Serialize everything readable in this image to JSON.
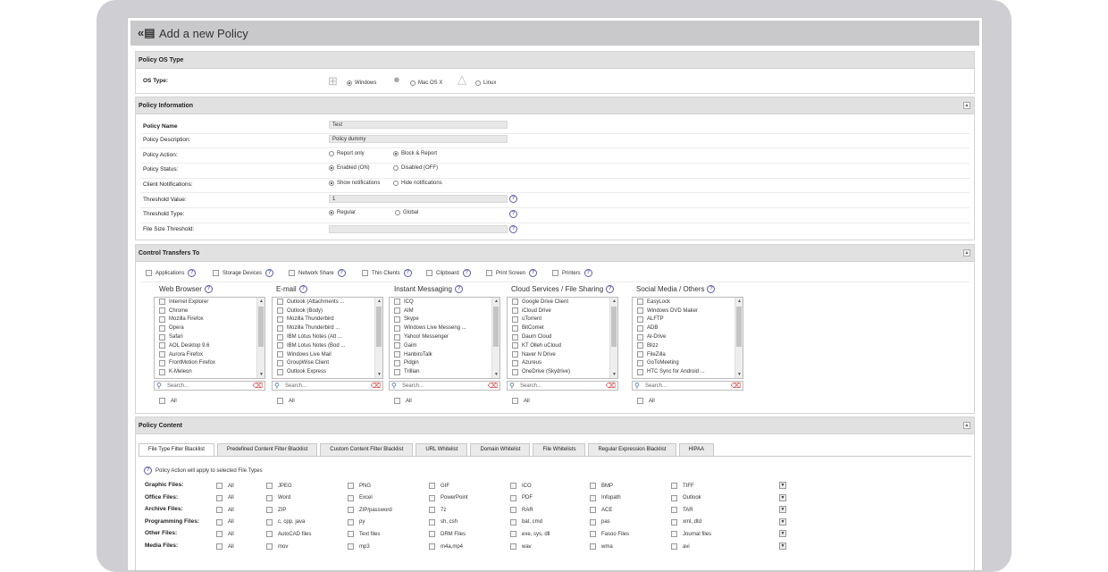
{
  "window": {
    "title": "Add a new Policy",
    "back_glyph": "«"
  },
  "os_type": {
    "header": "Policy OS Type",
    "label": "OS Type:",
    "options": [
      {
        "label": "Windows",
        "selected": true
      },
      {
        "label": "Mac OS X",
        "selected": false
      },
      {
        "label": "Linux",
        "selected": false
      }
    ]
  },
  "policy_info": {
    "header": "Policy Information",
    "name_label": "Policy Name",
    "name_value": "Test",
    "description_label": "Policy Description:",
    "description_value": "Policy dummy",
    "action_label": "Policy Action:",
    "action_options": [
      {
        "label": "Report only",
        "selected": false
      },
      {
        "label": "Block & Report",
        "selected": true
      }
    ],
    "status_label": "Policy Status:",
    "status_options": [
      {
        "label": "Enabled (ON)",
        "selected": true
      },
      {
        "label": "Disabled (OFF)",
        "selected": false
      }
    ],
    "notifications_label": "Client Notifications:",
    "notifications_options": [
      {
        "label": "Show notifications",
        "selected": true
      },
      {
        "label": "Hide notifications",
        "selected": false
      }
    ],
    "threshold_label": "Threshold Value:",
    "threshold_value": "1",
    "threshold_type_label": "Threshold Type:",
    "threshold_type_options": [
      {
        "label": "Regular",
        "selected": true
      },
      {
        "label": "Global",
        "selected": false
      }
    ],
    "file_size_label": "File Size Threshold:",
    "file_size_value": ""
  },
  "control_transfers": {
    "header": "Control Transfers To",
    "top_options": [
      "Applications",
      "Storage Devices",
      "Network Share",
      "Thin Clients",
      "Clipboard",
      "Print Screen",
      "Printers"
    ],
    "columns": [
      {
        "title": "Web Browser",
        "items": [
          "Internet Explorer",
          "Chrome",
          "Mozilla Firefox",
          "Opera",
          "Safari",
          "AOL Desktop 9.6",
          "Aurora Firefox",
          "FrontMotion Firefox",
          "K-Meleon"
        ]
      },
      {
        "title": "E-mail",
        "items": [
          "Outlook (Attachments ...",
          "Outlook (Body)",
          "Mozilla Thunderbird",
          "Mozilla Thunderbird ...",
          "IBM Lotus Notes (Att ...",
          "IBM Lotus Notes (Bod ...",
          "Windows Live Mail",
          "GroupWise Client",
          "Outlook Express"
        ]
      },
      {
        "title": "Instant Messaging",
        "items": [
          "ICQ",
          "AIM",
          "Skype",
          "Windows Live Messeng ...",
          "Yahoo! Messenger",
          "Gaim",
          "HanbiroTalk",
          "Pidgin",
          "Trillian"
        ]
      },
      {
        "title": "Cloud Services / File Sharing",
        "items": [
          "Google Drive Client",
          "iCloud Drive",
          "uTorrent",
          "BitComet",
          "Daum Cloud",
          "KT Olleh uCloud",
          "Naver N Drive",
          "Azureus",
          "OneDrive (Skydrive)"
        ]
      },
      {
        "title": "Social Media / Others",
        "items": [
          "EasyLock",
          "Windows DVD Maker",
          "ALFTP",
          "ADB",
          "Al-Drive",
          "Blizz",
          "FileZilla",
          "GoToMeeting",
          "HTC Sync for Android ..."
        ]
      }
    ],
    "search_placeholder": "Search...",
    "all_label": "All"
  },
  "policy_content": {
    "header": "Policy Content",
    "tabs": [
      "File Type Filter Blacklist",
      "Predefined Content Filter Blacklist",
      "Custom Content Filter Blacklist",
      "URL Whitelist",
      "Domain Whitelist",
      "File Whitelists",
      "Regular Expression Blacklist",
      "HIPAA"
    ],
    "note": "Policy Action will apply to selected File Types",
    "rows": [
      {
        "label": "Graphic Files:",
        "cells": [
          "All",
          "JPEG",
          "PNG",
          "GIF",
          "ICO",
          "BMP",
          "TIFF"
        ]
      },
      {
        "label": "Office Files:",
        "cells": [
          "All",
          "Word",
          "Excel",
          "PowerPoint",
          "PDF",
          "Infopath",
          "Outlook"
        ]
      },
      {
        "label": "Archive Files:",
        "cells": [
          "All",
          "ZIP",
          "ZIP/password",
          "7z",
          "RAR",
          "ACE",
          "TAR"
        ]
      },
      {
        "label": "Programming Files:",
        "cells": [
          "All",
          "c, cpp, java",
          "py",
          "sh, csh",
          "bat, cmd",
          "pas",
          "xml, dtd"
        ]
      },
      {
        "label": "Other Files:",
        "cells": [
          "All",
          "AutoCAD files",
          "Text files",
          "DRM Files",
          "exe, sys, dll",
          "Fasoo Files",
          "Journal files"
        ]
      },
      {
        "label": "Media Files:",
        "cells": [
          "All",
          "mov",
          "mp3",
          "m4a,mp4",
          "wav",
          "wma",
          "avi"
        ]
      }
    ]
  }
}
